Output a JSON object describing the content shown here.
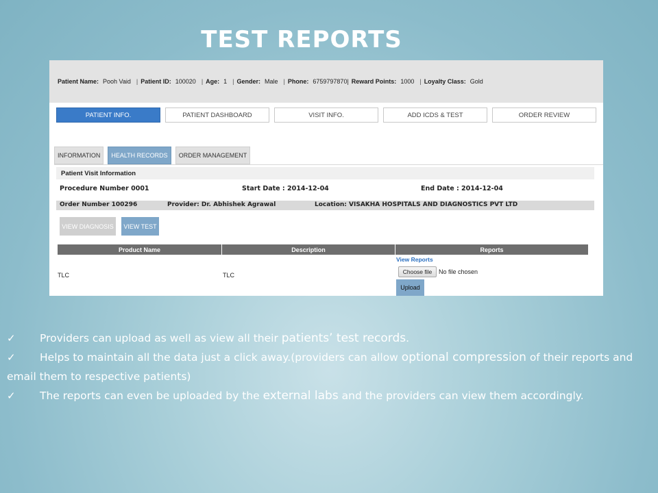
{
  "title": "TEST REPORTS",
  "patient_bar": [
    {
      "label": "Patient Name:",
      "value": "Pooh Vaid"
    },
    {
      "label": "Patient ID:",
      "value": "100020"
    },
    {
      "label": "Age:",
      "value": "1"
    },
    {
      "label": "Gender:",
      "value": "Male"
    },
    {
      "label": "Phone:",
      "value": "6759797870|"
    },
    {
      "label": "Reward Points:",
      "value": "1000"
    },
    {
      "label": "Loyalty Class:",
      "value": "Gold"
    }
  ],
  "nav_tabs": [
    "PATIENT INFO.",
    "PATIENT DASHBOARD",
    "VISIT INFO.",
    "ADD ICDS & TEST",
    "ORDER REVIEW"
  ],
  "active_nav_tab": "PATIENT INFO.",
  "sub_tabs": [
    "INFORMATION",
    "HEALTH RECORDS",
    "ORDER MANAGEMENT"
  ],
  "active_sub_tab": "HEALTH RECORDS",
  "visit": {
    "header": "Patient Visit Information",
    "procedure": "Procedure Number 0001",
    "start_date": "Start Date : 2014-12-04",
    "end_date": "End Date : 2014-12-04",
    "order_number": "Order Number  100296",
    "provider": "Provider:  Dr. Abhishek Agrawal",
    "location": "Location:  VISAKHA HOSPITALS AND DIAGNOSTICS PVT LTD"
  },
  "buttons": {
    "view_diagnosis": "VIEW DIAGNOSIS",
    "view_test": "VIEW TEST"
  },
  "table": {
    "headers": [
      "Product Name",
      "Description",
      "Reports"
    ],
    "rows": [
      {
        "product": "TLC",
        "description": "TLC",
        "view_reports": "View Reports",
        "choose_file": "Choose file",
        "file_status": "No file chosen",
        "upload": "Upload"
      }
    ]
  },
  "bullets": [
    {
      "pre": "Providers can  upload as well as view all their ",
      "em": "patients’ test records",
      "post": "."
    },
    {
      "pre": "Helps to maintain all the data just a click away.(providers can allow ",
      "em": "optional compression",
      "post": " of their reports and email them to respective patients)"
    },
    {
      "pre": "The reports can even be uploaded by the ",
      "em": "external labs",
      "post": " and the providers can view them accordingly."
    }
  ],
  "check_icon": "✓"
}
